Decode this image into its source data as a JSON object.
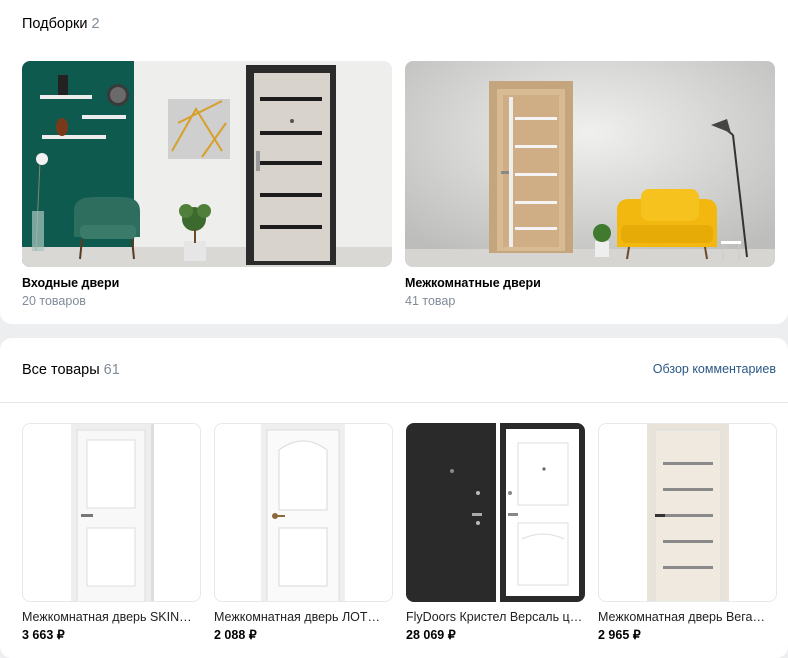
{
  "collections": {
    "title": "Подборки",
    "count": "2",
    "items": [
      {
        "name": "Входные двери",
        "sub": "20 товаров"
      },
      {
        "name": "Межкомнатные двери",
        "sub": "41 товар"
      }
    ]
  },
  "products": {
    "title": "Все товары",
    "count": "61",
    "link": "Обзор комментариев",
    "items": [
      {
        "name": "Межкомнатная дверь SKIN…",
        "price": "3 663 ₽"
      },
      {
        "name": "Межкомнатная дверь ЛОТ…",
        "price": "2 088 ₽"
      },
      {
        "name": "FlyDoors Кристел Версаль ц…",
        "price": "28 069 ₽"
      },
      {
        "name": "Межкомнатная дверь Вега…",
        "price": "2 965 ₽"
      }
    ]
  },
  "colors": {
    "accent_link": "#2a5885",
    "muted": "#818c99",
    "teal_wall": "#0f5a4f",
    "armchair_yellow": "#f2b80f"
  }
}
